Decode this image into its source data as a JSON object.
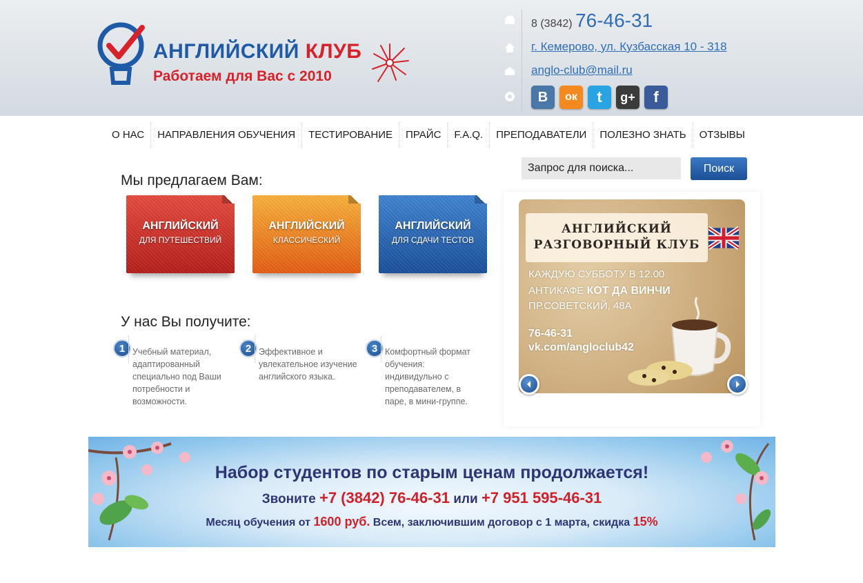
{
  "header": {
    "logo": {
      "title_part1": "АНГЛИЙСКИЙ ",
      "title_part2": "КЛУБ",
      "subtitle": "Работаем для Вас с 2010"
    },
    "contacts": {
      "phone_code": "8 (3842)",
      "phone_number": "76-46-31",
      "address": "г. Кемерово, ул. Кузбасская 10 - 318",
      "email": "anglo-club@mail.ru"
    },
    "social": [
      {
        "name": "vk",
        "glyph": "B",
        "color": "#4b76a8"
      },
      {
        "name": "odnoklassniki",
        "glyph": "ок",
        "color": "#f48a1f"
      },
      {
        "name": "twitter",
        "glyph": "t",
        "color": "#2aa3e3"
      },
      {
        "name": "google-plus",
        "glyph": "g+",
        "color": "#3b3b3b"
      },
      {
        "name": "facebook",
        "glyph": "f",
        "color": "#3b5a9a"
      }
    ]
  },
  "nav": {
    "items": [
      "О НАС",
      "НАПРАВЛЕНИЯ ОБУЧЕНИЯ",
      "ТЕСТИРОВАНИЕ",
      "ПРАЙС",
      "F.A.Q.",
      "ПРЕПОДАВАТЕЛИ",
      "ПОЛЕЗНО ЗНАТЬ",
      "ОТЗЫВЫ"
    ]
  },
  "search": {
    "placeholder": "Запрос для поиска...",
    "button": "Поиск"
  },
  "offer": {
    "heading": "Мы предлагаем Вам:",
    "cards": [
      {
        "line1": "АНГЛИЙСКИЙ",
        "line2": "ДЛЯ ПУТЕШЕСТВИЙ"
      },
      {
        "line1": "АНГЛИЙСКИЙ",
        "line2": "КЛАССИЧЕСКИЙ"
      },
      {
        "line1": "АНГЛИЙСКИЙ",
        "line2": "ДЛЯ СДАЧИ ТЕСТОВ"
      }
    ]
  },
  "benefits": {
    "heading": "У нас Вы получите:",
    "items": [
      {
        "num": "1",
        "text": "Учебный материал, адаптированный специально под Ваши потребности и возможности."
      },
      {
        "num": "2",
        "text": "Эффективное и увлекательное изучение английского языка."
      },
      {
        "num": "3",
        "text": "Комфортный формат обучения: индивидульно с преподавателем, в паре, в мини-группе."
      }
    ]
  },
  "slider": {
    "title1": "АНГЛИЙСКИЙ",
    "title2": "РАЗГОВОРНЫЙ КЛУБ",
    "line1": "КАЖДУЮ СУББОТУ В 12.00",
    "line2_prefix": "АНТИКАФЕ ",
    "line2_bold": "КОТ ДА ВИНЧИ",
    "line3": "ПР.СОВЕТСКИЙ, 48А",
    "phone": "76-46-31",
    "vk": "vk.com/angloclub42"
  },
  "banner": {
    "line1": "Набор студентов по старым ценам продолжается!",
    "line2_a": "Звоните ",
    "line2_phone1": "+7 (3842) 76-46-31",
    "line2_b": " или ",
    "line2_phone2": "+7 951 595-46-31",
    "line3_a": "Месяц обучения от ",
    "line3_price": "1600 руб.",
    "line3_b": " Всем, заключившим договор с 1 марта, скидка ",
    "line3_discount": "15%"
  }
}
